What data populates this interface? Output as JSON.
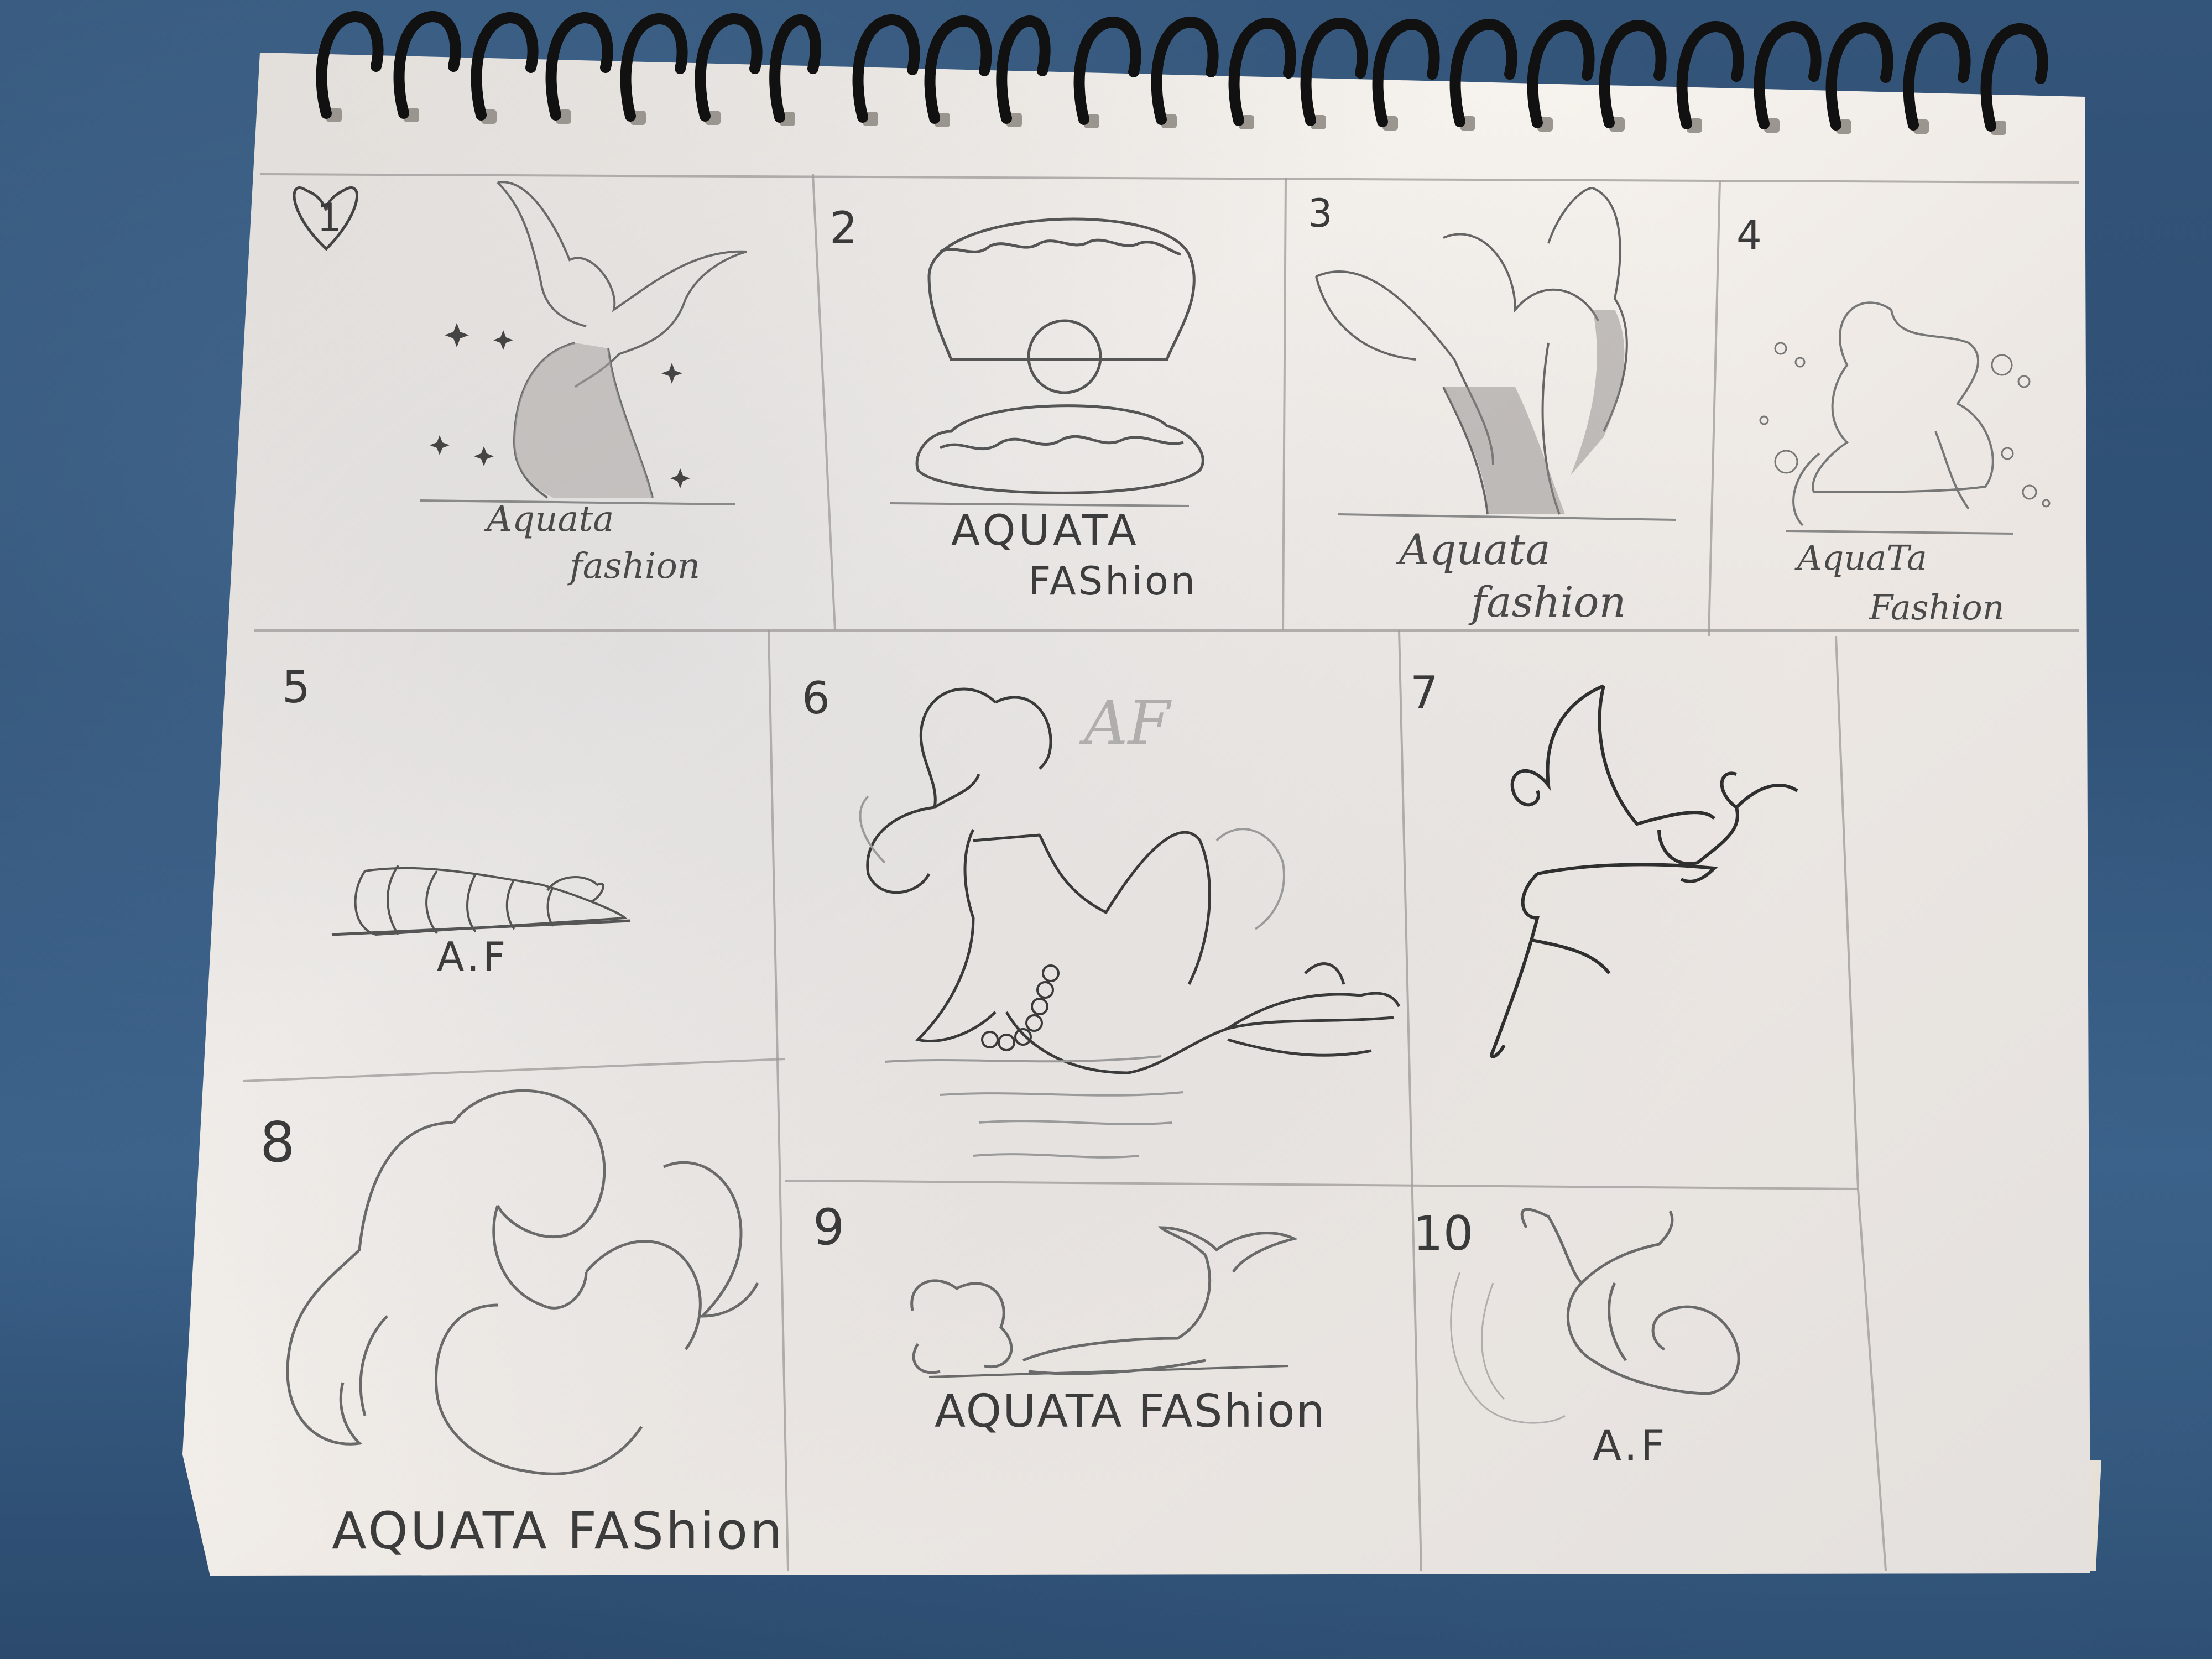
{
  "sketchbook": {
    "panels": [
      {
        "number": "1",
        "caption_line1": "Aquata",
        "caption_line2": "fashion"
      },
      {
        "number": "2",
        "caption_line1": "AQUATA",
        "caption_line2": "FAShion"
      },
      {
        "number": "3",
        "caption_line1": "Aquata",
        "caption_line2": "fashion"
      },
      {
        "number": "4",
        "caption_line1": "AquaTa",
        "caption_line2": "Fashion"
      },
      {
        "number": "5",
        "caption_line1": "A.F"
      },
      {
        "number": "6",
        "caption_line1": "AF"
      },
      {
        "number": "7"
      },
      {
        "number": "8",
        "caption_line1": "AQUATA FAShion"
      },
      {
        "number": "9",
        "caption_line1": "AQUATA FAShion"
      },
      {
        "number": "10",
        "caption_line1": "A.F"
      }
    ]
  },
  "colors": {
    "fabric": "#34567b",
    "paper": "#f1ece6",
    "pencil": "#4a4a4a",
    "ring": "#111111"
  }
}
